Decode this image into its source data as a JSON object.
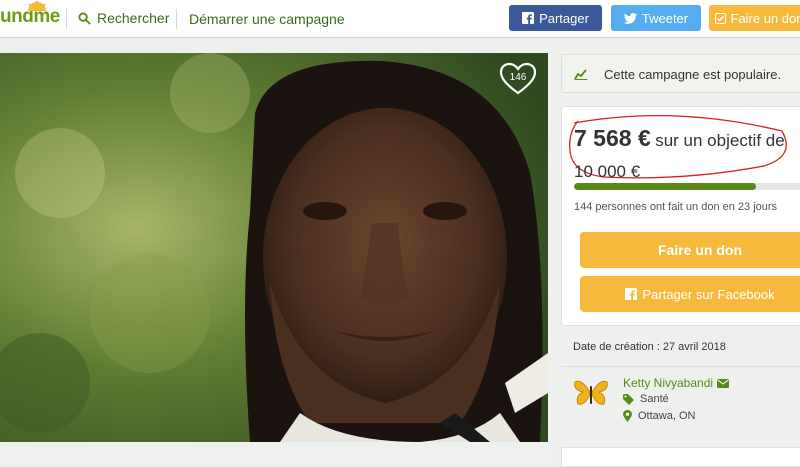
{
  "header": {
    "logo_text": "und",
    "logo_me": "me",
    "search_label": "Rechercher",
    "start_label": "Démarrer une campagne",
    "share_label": "Partager",
    "tweet_label": "Tweeter",
    "donate_label": "Faire un don"
  },
  "campaign": {
    "heart_count": "146",
    "popular_text": "Cette campagne est populaire.",
    "amount_raised": "7 568 €",
    "amount_text": "sur un objectif de",
    "goal": "10 000 €",
    "progress_fraction": 0.7568,
    "donors_text": "144 personnes ont fait un don en 23 jours",
    "donate_button": "Faire un don",
    "share_fb_button": "Partager sur Facebook",
    "created_text": "Date de création : 27 avril 2018"
  },
  "organizer": {
    "name": "Ketty Nivyabandi",
    "category": "Santé",
    "location": "Ottawa, ON"
  },
  "colors": {
    "brand_green": "#5a8a16",
    "donate_orange": "#f6b93b",
    "facebook_blue": "#3b5998",
    "twitter_blue": "#55acee"
  }
}
